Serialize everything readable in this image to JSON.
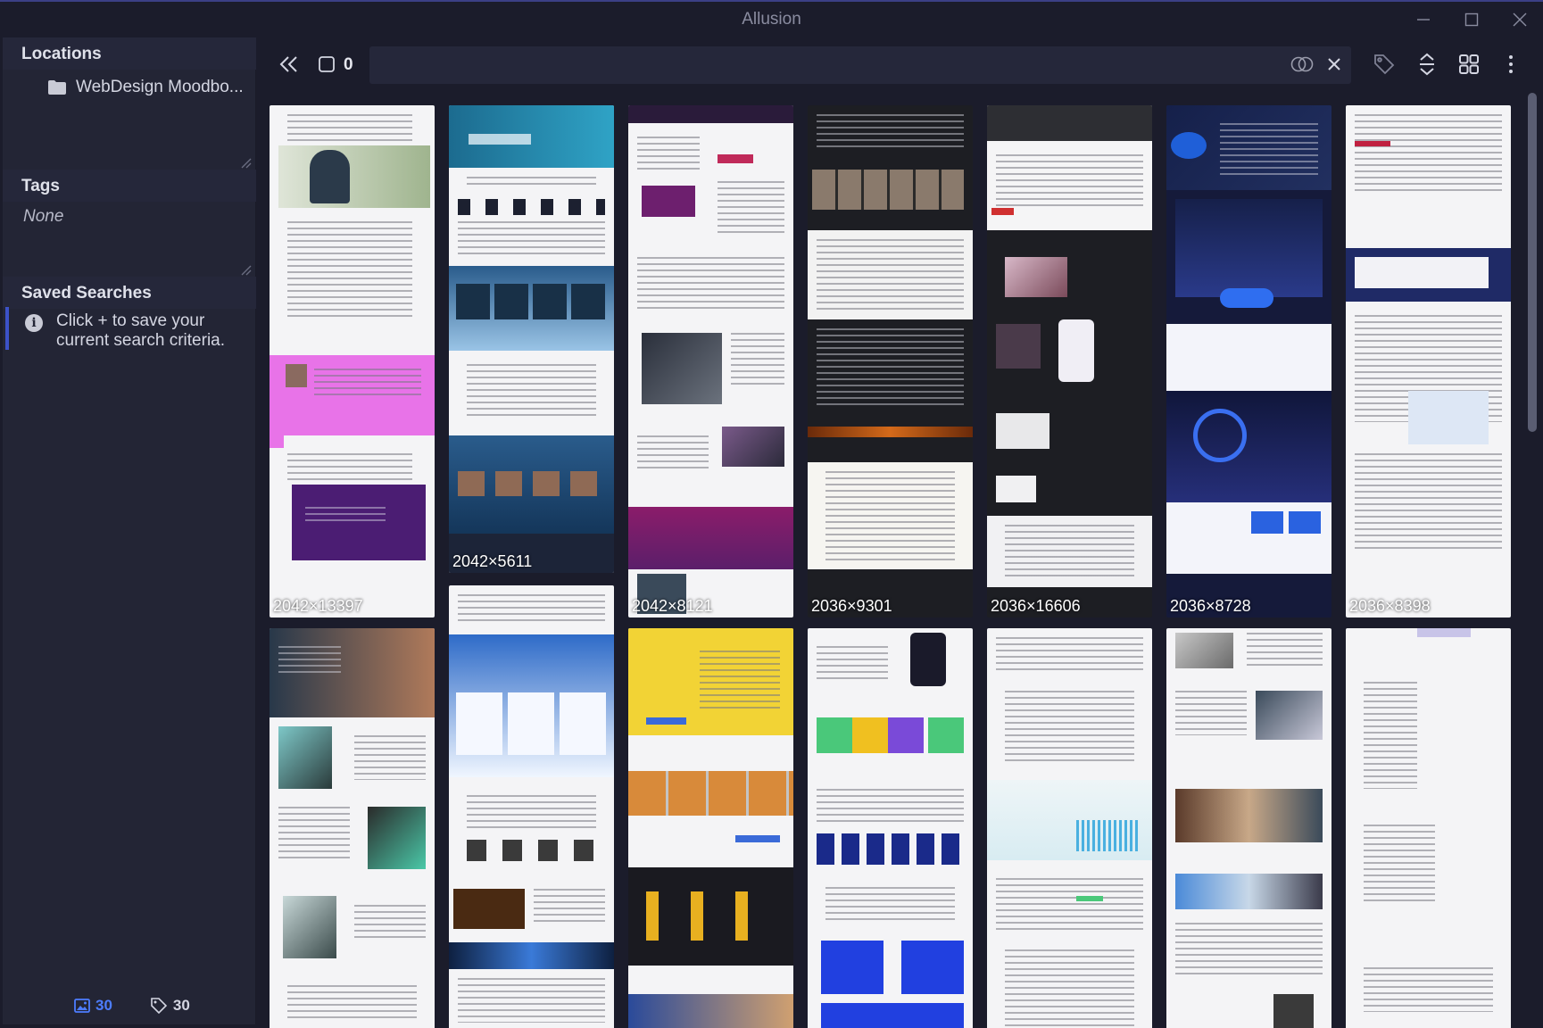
{
  "window": {
    "title": "Allusion"
  },
  "sidebar": {
    "locations": {
      "header": "Locations",
      "items": [
        {
          "label": "WebDesign Moodbo..."
        }
      ]
    },
    "tags": {
      "header": "Tags",
      "empty_text": "None"
    },
    "saved_searches": {
      "header": "Saved Searches",
      "hint": "Click + to save your current search criteria."
    },
    "footer": {
      "image_count": "30",
      "tag_count": "30"
    }
  },
  "toolbar": {
    "selection_count": "0",
    "search_value": "",
    "icons": [
      "double-chevron-left-icon",
      "checkbox-icon",
      "toggle-invert-icon",
      "clear-icon",
      "tag-icon",
      "sort-icon",
      "grid-view-icon",
      "more-icon"
    ]
  },
  "gallery": {
    "items": [
      {
        "dims": "2042×13397"
      },
      {
        "dims": "2042×5611"
      },
      {
        "dims": "2042×8121"
      },
      {
        "dims": "2036×9301"
      },
      {
        "dims": "2036×16606"
      },
      {
        "dims": "2036×8728"
      },
      {
        "dims": "2036×8398"
      },
      {
        "dims": ""
      },
      {
        "dims": ""
      },
      {
        "dims": ""
      },
      {
        "dims": ""
      },
      {
        "dims": ""
      },
      {
        "dims": ""
      },
      {
        "dims": ""
      },
      {
        "dims": ""
      }
    ]
  },
  "colors": {
    "background": "#1b1c2b",
    "sidebar": "#232535",
    "accent": "#4d7dff",
    "selection_bar": "#3c52c8"
  }
}
